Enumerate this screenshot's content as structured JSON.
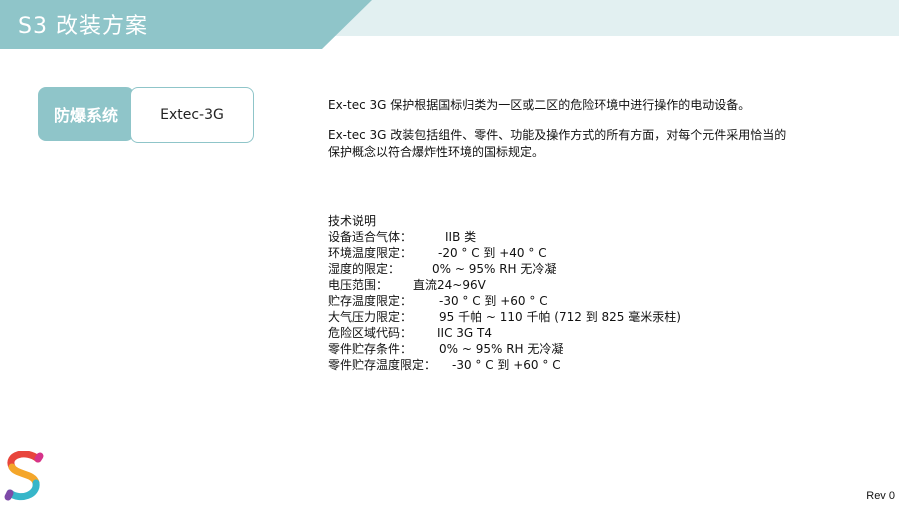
{
  "header": {
    "title": "S3 改装方案",
    "colors": {
      "dark_band": "#8fc5c9",
      "light_band": "#e2f0f1"
    }
  },
  "system": {
    "label": "防爆系统",
    "value": "Extec-3G"
  },
  "description": {
    "paragraphs": [
      "Ex-tec 3G 保护根据国标归类为一区或二区的危险环境中进行操作的电动设备。",
      "Ex-tec 3G 改装包括组件、零件、功能及操作方式的所有方面，对每个元件采用恰当的保护概念以符合爆炸性环境的国标规定。"
    ]
  },
  "specs": {
    "heading": "技术说明",
    "rows": [
      {
        "label": "设备适合气体：",
        "value": "IIB 类"
      },
      {
        "label": "环境温度限定：",
        "value": "-20 ° C 到 +40 ° C"
      },
      {
        "label": "湿度的限定：",
        "value": "0% ~ 95% RH 无冷凝"
      },
      {
        "label": "电压范围：",
        "value": "直流24~96V"
      },
      {
        "label": "贮存温度限定：",
        "value": "-30 ° C 到 +60 ° C"
      },
      {
        "label": "大气压力限定：",
        "value": "95 千帕 ~ 110 千帕 (712 到 825 毫米汞柱)"
      },
      {
        "label": "危险区域代码：",
        "value": "IIC 3G T4"
      },
      {
        "label": "零件贮存条件：",
        "value": "0% ~ 95% RH 无冷凝"
      },
      {
        "label": "零件贮存温度限定：",
        "value": "-30 ° C 到 +60 ° C"
      }
    ]
  },
  "logo": {
    "icon": "s-logo-icon"
  },
  "footer": {
    "revision": "Rev 0"
  }
}
